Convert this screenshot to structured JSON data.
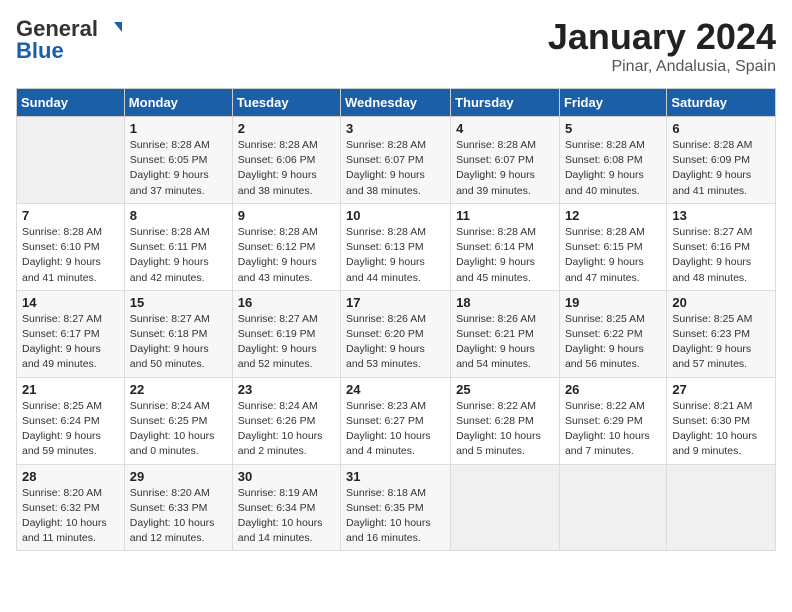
{
  "header": {
    "logo_general": "General",
    "logo_blue": "Blue",
    "title": "January 2024",
    "subtitle": "Pinar, Andalusia, Spain"
  },
  "calendar": {
    "days_of_week": [
      "Sunday",
      "Monday",
      "Tuesday",
      "Wednesday",
      "Thursday",
      "Friday",
      "Saturday"
    ],
    "weeks": [
      [
        {
          "num": "",
          "detail": ""
        },
        {
          "num": "1",
          "detail": "Sunrise: 8:28 AM\nSunset: 6:05 PM\nDaylight: 9 hours\nand 37 minutes."
        },
        {
          "num": "2",
          "detail": "Sunrise: 8:28 AM\nSunset: 6:06 PM\nDaylight: 9 hours\nand 38 minutes."
        },
        {
          "num": "3",
          "detail": "Sunrise: 8:28 AM\nSunset: 6:07 PM\nDaylight: 9 hours\nand 38 minutes."
        },
        {
          "num": "4",
          "detail": "Sunrise: 8:28 AM\nSunset: 6:07 PM\nDaylight: 9 hours\nand 39 minutes."
        },
        {
          "num": "5",
          "detail": "Sunrise: 8:28 AM\nSunset: 6:08 PM\nDaylight: 9 hours\nand 40 minutes."
        },
        {
          "num": "6",
          "detail": "Sunrise: 8:28 AM\nSunset: 6:09 PM\nDaylight: 9 hours\nand 41 minutes."
        }
      ],
      [
        {
          "num": "7",
          "detail": "Sunrise: 8:28 AM\nSunset: 6:10 PM\nDaylight: 9 hours\nand 41 minutes."
        },
        {
          "num": "8",
          "detail": "Sunrise: 8:28 AM\nSunset: 6:11 PM\nDaylight: 9 hours\nand 42 minutes."
        },
        {
          "num": "9",
          "detail": "Sunrise: 8:28 AM\nSunset: 6:12 PM\nDaylight: 9 hours\nand 43 minutes."
        },
        {
          "num": "10",
          "detail": "Sunrise: 8:28 AM\nSunset: 6:13 PM\nDaylight: 9 hours\nand 44 minutes."
        },
        {
          "num": "11",
          "detail": "Sunrise: 8:28 AM\nSunset: 6:14 PM\nDaylight: 9 hours\nand 45 minutes."
        },
        {
          "num": "12",
          "detail": "Sunrise: 8:28 AM\nSunset: 6:15 PM\nDaylight: 9 hours\nand 47 minutes."
        },
        {
          "num": "13",
          "detail": "Sunrise: 8:27 AM\nSunset: 6:16 PM\nDaylight: 9 hours\nand 48 minutes."
        }
      ],
      [
        {
          "num": "14",
          "detail": "Sunrise: 8:27 AM\nSunset: 6:17 PM\nDaylight: 9 hours\nand 49 minutes."
        },
        {
          "num": "15",
          "detail": "Sunrise: 8:27 AM\nSunset: 6:18 PM\nDaylight: 9 hours\nand 50 minutes."
        },
        {
          "num": "16",
          "detail": "Sunrise: 8:27 AM\nSunset: 6:19 PM\nDaylight: 9 hours\nand 52 minutes."
        },
        {
          "num": "17",
          "detail": "Sunrise: 8:26 AM\nSunset: 6:20 PM\nDaylight: 9 hours\nand 53 minutes."
        },
        {
          "num": "18",
          "detail": "Sunrise: 8:26 AM\nSunset: 6:21 PM\nDaylight: 9 hours\nand 54 minutes."
        },
        {
          "num": "19",
          "detail": "Sunrise: 8:25 AM\nSunset: 6:22 PM\nDaylight: 9 hours\nand 56 minutes."
        },
        {
          "num": "20",
          "detail": "Sunrise: 8:25 AM\nSunset: 6:23 PM\nDaylight: 9 hours\nand 57 minutes."
        }
      ],
      [
        {
          "num": "21",
          "detail": "Sunrise: 8:25 AM\nSunset: 6:24 PM\nDaylight: 9 hours\nand 59 minutes."
        },
        {
          "num": "22",
          "detail": "Sunrise: 8:24 AM\nSunset: 6:25 PM\nDaylight: 10 hours\nand 0 minutes."
        },
        {
          "num": "23",
          "detail": "Sunrise: 8:24 AM\nSunset: 6:26 PM\nDaylight: 10 hours\nand 2 minutes."
        },
        {
          "num": "24",
          "detail": "Sunrise: 8:23 AM\nSunset: 6:27 PM\nDaylight: 10 hours\nand 4 minutes."
        },
        {
          "num": "25",
          "detail": "Sunrise: 8:22 AM\nSunset: 6:28 PM\nDaylight: 10 hours\nand 5 minutes."
        },
        {
          "num": "26",
          "detail": "Sunrise: 8:22 AM\nSunset: 6:29 PM\nDaylight: 10 hours\nand 7 minutes."
        },
        {
          "num": "27",
          "detail": "Sunrise: 8:21 AM\nSunset: 6:30 PM\nDaylight: 10 hours\nand 9 minutes."
        }
      ],
      [
        {
          "num": "28",
          "detail": "Sunrise: 8:20 AM\nSunset: 6:32 PM\nDaylight: 10 hours\nand 11 minutes."
        },
        {
          "num": "29",
          "detail": "Sunrise: 8:20 AM\nSunset: 6:33 PM\nDaylight: 10 hours\nand 12 minutes."
        },
        {
          "num": "30",
          "detail": "Sunrise: 8:19 AM\nSunset: 6:34 PM\nDaylight: 10 hours\nand 14 minutes."
        },
        {
          "num": "31",
          "detail": "Sunrise: 8:18 AM\nSunset: 6:35 PM\nDaylight: 10 hours\nand 16 minutes."
        },
        {
          "num": "",
          "detail": ""
        },
        {
          "num": "",
          "detail": ""
        },
        {
          "num": "",
          "detail": ""
        }
      ]
    ]
  }
}
